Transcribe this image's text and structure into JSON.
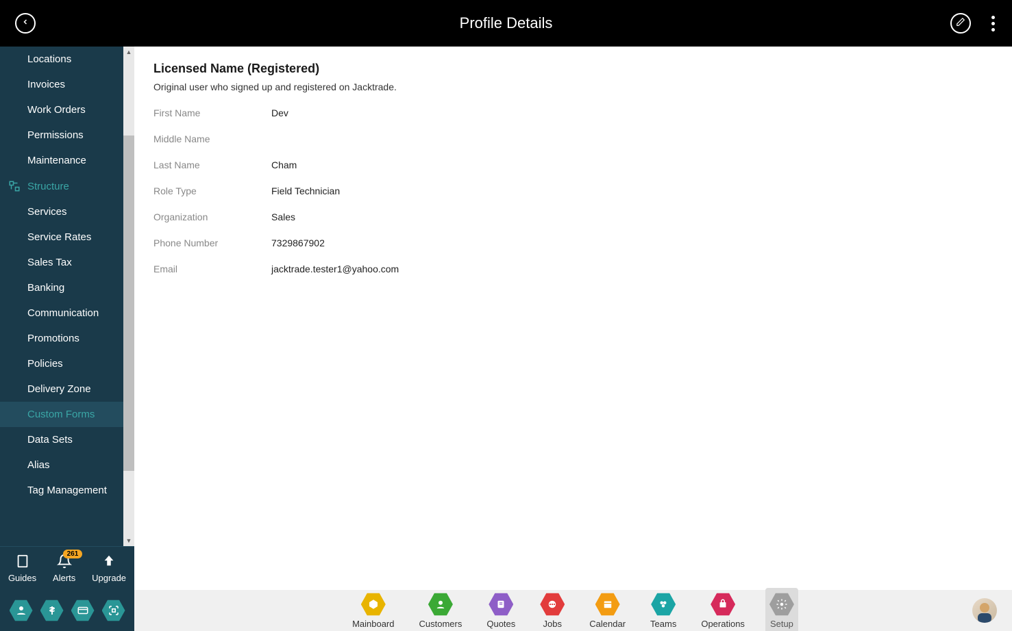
{
  "header": {
    "title": "Profile Details"
  },
  "sidebar": {
    "items": [
      {
        "label": "Locations"
      },
      {
        "label": "Invoices"
      },
      {
        "label": "Work Orders"
      },
      {
        "label": "Permissions"
      },
      {
        "label": "Maintenance"
      }
    ],
    "structure_header": "Structure",
    "structure_items": [
      {
        "label": "Services"
      },
      {
        "label": "Service Rates"
      },
      {
        "label": "Sales Tax"
      },
      {
        "label": "Banking"
      },
      {
        "label": "Communication"
      },
      {
        "label": "Promotions"
      },
      {
        "label": "Policies"
      },
      {
        "label": "Delivery Zone"
      },
      {
        "label": "Custom Forms"
      },
      {
        "label": "Data Sets"
      },
      {
        "label": "Alias"
      },
      {
        "label": "Tag Management"
      }
    ],
    "footer": {
      "guides": "Guides",
      "alerts": "Alerts",
      "alerts_count": "261",
      "upgrade": "Upgrade"
    }
  },
  "profile": {
    "section_title": "Licensed Name (Registered)",
    "section_desc": "Original user who signed up and registered on Jacktrade.",
    "fields": [
      {
        "label": "First Name",
        "value": "Dev"
      },
      {
        "label": "Middle Name",
        "value": ""
      },
      {
        "label": "Last Name",
        "value": "Cham"
      },
      {
        "label": "Role Type",
        "value": "Field Technician"
      },
      {
        "label": "Organization",
        "value": "Sales"
      },
      {
        "label": "Phone Number",
        "value": "7329867902"
      },
      {
        "label": "Email",
        "value": "jacktrade.tester1@yahoo.com"
      }
    ]
  },
  "bottomnav": [
    {
      "label": "Mainboard",
      "color": "#e8b400"
    },
    {
      "label": "Customers",
      "color": "#3ba935"
    },
    {
      "label": "Quotes",
      "color": "#8e5ec7"
    },
    {
      "label": "Jobs",
      "color": "#e23c3c"
    },
    {
      "label": "Calendar",
      "color": "#f39c12"
    },
    {
      "label": "Teams",
      "color": "#1ba5a5"
    },
    {
      "label": "Operations",
      "color": "#d62a5b"
    },
    {
      "label": "Setup",
      "color": "#9e9e9e"
    }
  ]
}
